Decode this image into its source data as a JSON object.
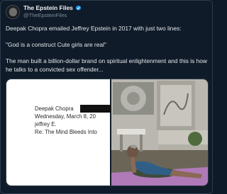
{
  "author": {
    "name": "The Epstein Files",
    "handle": "@TheEpsteinFiles"
  },
  "post": {
    "line1": "Deepak Chopra emailed Jeffrey Epstein in 2017 with just two lines:",
    "line2": "\"God is a construct Cute girls are real\"",
    "line3": "The man built a billion-dollar brand on spiritual enlightenment and this is how he talks to a convicted sex offender..."
  },
  "email_image": {
    "from": "Deepak Chopra",
    "date": "Wednesday, March 8, 20",
    "to": "jeffrey E.",
    "subject": "Re: The Mind Bleeds Into"
  },
  "colors": {
    "background": "#0f1b29",
    "verified": "#1d9bf0",
    "yoga_mat": "#b07ab8"
  }
}
